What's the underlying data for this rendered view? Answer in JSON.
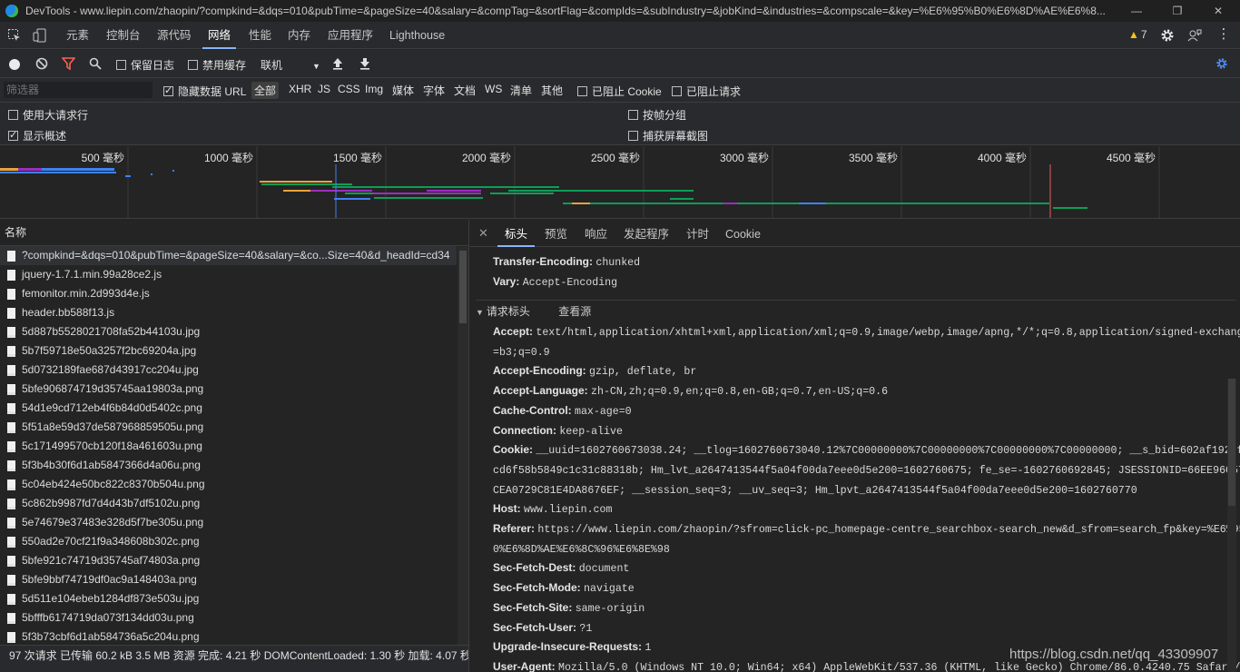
{
  "window": {
    "title": "DevTools - www.liepin.com/zhaopin/?compkind=&dqs=010&pubTime=&pageSize=40&salary=&compTag=&sortFlag=&compIds=&subIndustry=&jobKind=&industries=&compscale=&key=%E6%95%B0%E6%8D%AE%E6%8...",
    "minimize": "—",
    "restore": "❐",
    "close": "✕"
  },
  "main_tabs": [
    "元素",
    "控制台",
    "源代码",
    "网络",
    "性能",
    "内存",
    "应用程序",
    "Lighthouse"
  ],
  "active_main_tab": "网络",
  "warnings": {
    "icon": "warning-triangle-icon",
    "count": "7"
  },
  "toolbar": {
    "preserve_log": "保留日志",
    "disable_cache": "禁用缓存",
    "throttle": "联机"
  },
  "filter": {
    "placeholder": "筛选器",
    "hide_data_urls": "隐藏数据 URL",
    "types": [
      "全部",
      "XHR",
      "JS",
      "CSS",
      "Img",
      "媒体",
      "字体",
      "文档",
      "WS",
      "清单",
      "其他"
    ],
    "active_type": "全部",
    "blocked_cookies": "已阻止 Cookie",
    "blocked_requests": "已阻止请求"
  },
  "options": {
    "large_rows": "使用大请求行",
    "show_overview": "显示概述",
    "group_by_frame": "按帧分组",
    "capture_screenshots": "捕获屏幕截图"
  },
  "timeline": {
    "ticks": [
      "500 毫秒",
      "1000 毫秒",
      "1500 毫秒",
      "2000 毫秒",
      "2500 毫秒",
      "3000 毫秒",
      "3500 毫秒",
      "4000 毫秒",
      "4500 毫秒"
    ],
    "colors": {
      "waiting": "#0f9d58",
      "download": "#3f82f4",
      "script": "#9b2fbf",
      "other": "#e8a33d",
      "dom": "#3f82f4",
      "load": "#e85b5b"
    }
  },
  "request_list": {
    "header": "名称",
    "items": [
      "?compkind=&dqs=010&pubTime=&pageSize=40&salary=&co...Size=40&d_headId=cd34",
      "jquery-1.7.1.min.99a28ce2.js",
      "femonitor.min.2d993d4e.js",
      "header.bb588f13.js",
      "5d887b5528021708fa52b44103u.jpg",
      "5b7f59718e50a3257f2bc69204a.jpg",
      "5d0732189fae687d43917cc204u.jpg",
      "5bfe906874719d35745aa19803a.png",
      "54d1e9cd712eb4f6b84d0d5402c.png",
      "5f51a8e59d37de587968859505u.png",
      "5c171499570cb120f18a461603u.png",
      "5f3b4b30f6d1ab5847366d4a06u.png",
      "5c04eb424e50bc822c8370b504u.png",
      "5c862b9987fd7d4d43b7df5102u.png",
      "5e74679e37483e328d5f7be305u.png",
      "550ad2e70cf21f9a348608b302c.png",
      "5bfe921c74719d35745af74803a.png",
      "5bfe9bbf74719df0ac9a148403a.png",
      "5d511e104ebeb1284df873e503u.jpg",
      "5bfffb6174719da073f134dd03u.png",
      "5f3b73cbf6d1ab584736a5c204u.png"
    ]
  },
  "status": "97 次请求 已传输 60.2 kB 3.5 MB 资源 完成: 4.21 秒 DOMContentLoaded: 1.30 秒 加载: 4.07 秒",
  "details": {
    "tabs": [
      "标头",
      "预览",
      "响应",
      "发起程序",
      "计时",
      "Cookie"
    ],
    "active_tab": "标头",
    "response_headers_tail": [
      {
        "k": "Transfer-Encoding:",
        "v": "chunked"
      },
      {
        "k": "Vary:",
        "v": "Accept-Encoding"
      }
    ],
    "request_section": {
      "title": "请求标头",
      "view_source": "查看源"
    },
    "request_headers": [
      {
        "k": "Accept:",
        "v": "text/html,application/xhtml+xml,application/xml;q=0.9,image/webp,image/apng,*/*;q=0.8,application/signed-exchange;v",
        "cont": "=b3;q=0.9"
      },
      {
        "k": "Accept-Encoding:",
        "v": "gzip, deflate, br"
      },
      {
        "k": "Accept-Language:",
        "v": "zh-CN,zh;q=0.9,en;q=0.8,en-GB;q=0.7,en-US;q=0.6"
      },
      {
        "k": "Cache-Control:",
        "v": "max-age=0"
      },
      {
        "k": "Connection:",
        "v": "keep-alive"
      },
      {
        "k": "Cookie:",
        "v": "__uuid=1602760673038.24; __tlog=1602760673040.12%7C00000000%7C00000000%7C00000000%7C00000000; __s_bid=602af1924f85b",
        "cont": "cd6f58b5849c1c31c88318b; Hm_lvt_a2647413544f5a04f00da7eee0d5e200=1602760675; fe_se=-1602760692845; JSESSIONID=66EE96C57211",
        "cont2": "CEA0729C81E4DA8676EF; __session_seq=3; __uv_seq=3; Hm_lpvt_a2647413544f5a04f00da7eee0d5e200=1602760770"
      },
      {
        "k": "Host:",
        "v": "www.liepin.com"
      },
      {
        "k": "Referer:",
        "v": "https://www.liepin.com/zhaopin/?sfrom=click-pc_homepage-centre_searchbox-search_new&d_sfrom=search_fp&key=%E6%95%B",
        "cont": "0%E6%8D%AE%E6%8C%96%E6%8E%98"
      },
      {
        "k": "Sec-Fetch-Dest:",
        "v": "document"
      },
      {
        "k": "Sec-Fetch-Mode:",
        "v": "navigate"
      },
      {
        "k": "Sec-Fetch-Site:",
        "v": "same-origin"
      },
      {
        "k": "Sec-Fetch-User:",
        "v": "?1"
      },
      {
        "k": "Upgrade-Insecure-Requests:",
        "v": "1"
      },
      {
        "k": "User-Agent:",
        "v": "Mozilla/5.0 (Windows NT 10.0; Win64; x64) AppleWebKit/537.36 (KHTML, like Gecko) Chrome/86.0.4240.75 Safari/53"
      }
    ]
  },
  "watermark": "https://blog.csdn.net/qq_43309907"
}
